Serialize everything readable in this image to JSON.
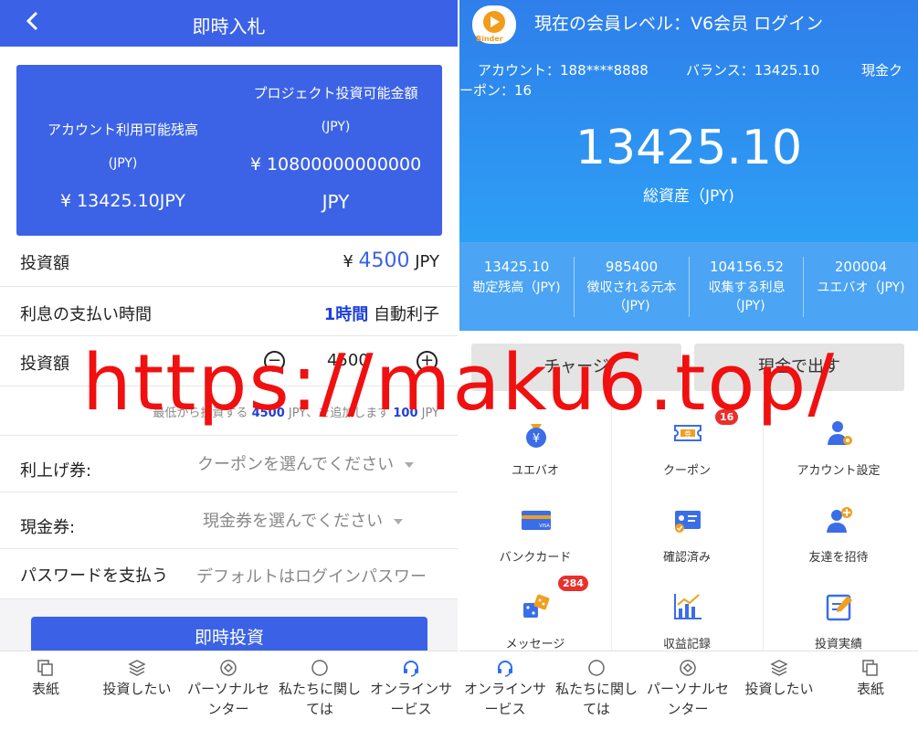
{
  "left": {
    "header": {
      "back_label": "<",
      "title": "即時入札"
    },
    "balance_card": {
      "available_label": "アカウント利用可能残高",
      "available_unit": "(JPY)",
      "available_value": "¥ 13425.10JPY",
      "project_label": "プロジェクト投資可能金額",
      "project_unit": "(JPY)",
      "project_value": "¥ 10800000000000",
      "project_currency": "JPY"
    },
    "invest_amount": {
      "label": "投資額",
      "currency_symbol": "¥",
      "value": "4500",
      "unit": "JPY"
    },
    "interest_time": {
      "label": "利息の支払い時間",
      "period": "1時間",
      "type": "自動利子"
    },
    "stepper": {
      "label": "投資額",
      "minus": "−",
      "value": "4500",
      "plus": "+"
    },
    "hint": {
      "prefix": "最低から投資する",
      "min": "4500",
      "mid": "JPY、を追加します",
      "step": "100",
      "suffix": "JPY"
    },
    "coupon": {
      "label": "利上げ券:",
      "placeholder": "クーポンを選んでください"
    },
    "cash_coupon": {
      "label": "現金券:",
      "placeholder": "現金券を選んでください"
    },
    "password": {
      "label": "パスワードを支払う",
      "placeholder": "デフォルトはログインパスワー"
    },
    "submit_label": "即時投資",
    "tabs": [
      {
        "label": "表紙"
      },
      {
        "label": "投資したい"
      },
      {
        "label": "パーソナルセンター"
      },
      {
        "label": "私たちに関しては"
      },
      {
        "label": "オンラインサービス"
      }
    ]
  },
  "right": {
    "logo_text": "Binder",
    "member_line": "現在の会員レベル：V6会员  ログイン",
    "account": "アカウント：188****8888",
    "balance": "バランス：13425.10",
    "cash_coupon_a": "現金ク",
    "cash_coupon_b": "ーポン：16",
    "total_value": "13425.10",
    "total_label": "総資産（JPY)",
    "stats": [
      {
        "value": "13425.10",
        "label": "勘定残高（JPY)"
      },
      {
        "value": "985400",
        "label": "徴収される元本（JPY)"
      },
      {
        "value": "104156.52",
        "label": "収集する利息（JPY)"
      },
      {
        "value": "200004",
        "label": "ユエバオ（JPY)"
      }
    ],
    "charge_label": "チャージ",
    "withdraw_label": "現金で出す",
    "grid": [
      {
        "label": "ユエバオ",
        "icon": "money-bag-icon"
      },
      {
        "label": "クーポン",
        "icon": "coupon-icon",
        "badge": "16"
      },
      {
        "label": "アカウント設定",
        "icon": "account-settings-icon"
      },
      {
        "label": "バンクカード",
        "icon": "bank-card-icon"
      },
      {
        "label": "確認済み",
        "icon": "verified-id-icon"
      },
      {
        "label": "友達を招待",
        "icon": "invite-friend-icon"
      },
      {
        "label": "メッセージ",
        "icon": "dice-message-icon",
        "badge": "284"
      },
      {
        "label": "収益記録",
        "icon": "earnings-chart-icon"
      },
      {
        "label": "投資実績",
        "icon": "investment-record-icon"
      }
    ],
    "tabs": [
      {
        "label": "オンラインサービス"
      },
      {
        "label": "私たちに関しては"
      },
      {
        "label": "パーソナルセンター"
      },
      {
        "label": "投資したい"
      },
      {
        "label": "表紙"
      }
    ]
  },
  "watermark": "https://maku6.top/",
  "colors": {
    "primary_blue": "#3b62e6",
    "hero_blue": "#2f8ff0",
    "badge_red": "#e8312c",
    "watermark_red": "#f01010"
  }
}
